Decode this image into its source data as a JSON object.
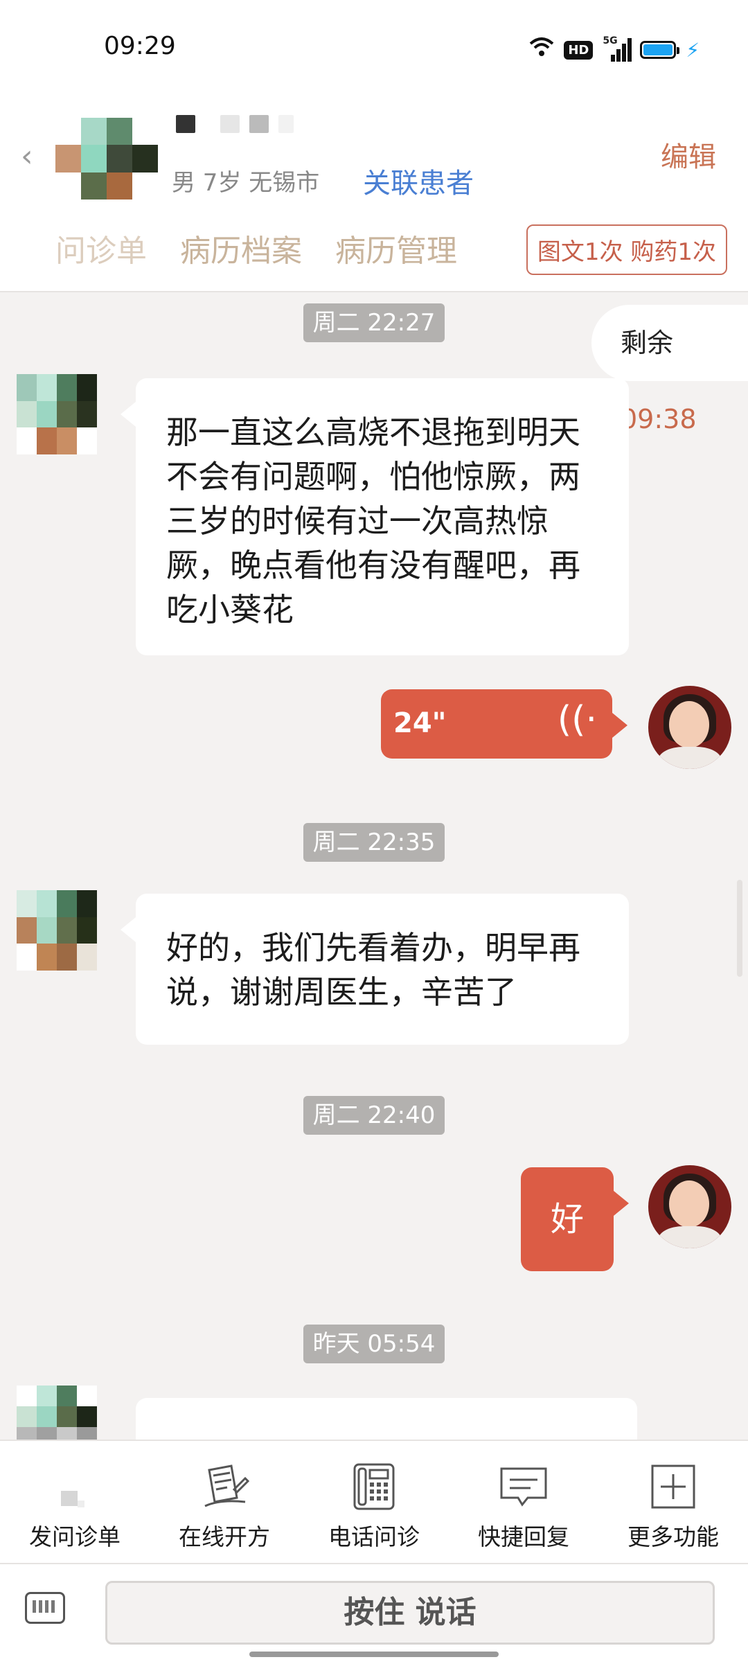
{
  "status_bar": {
    "time": "09:29",
    "network": "5G",
    "hd_label": "HD"
  },
  "header": {
    "patient_meta": "男 7岁  无锡市",
    "link_patient": "关联患者",
    "edit_button": "编辑",
    "tabs": [
      "问诊单",
      "病历档案",
      "病历管理"
    ],
    "service_chip": "图文1次 购药1次"
  },
  "chat": {
    "remain_label": "剩余",
    "remain_time": "09:38",
    "messages": [
      {
        "time": "周二 22:27",
        "text": "那一直这么高烧不退拖到明天不会有问题啊，怕他惊厥，两三岁的时候有过一次高热惊厥，晚点看他有没有醒吧，再吃小葵花"
      },
      {
        "voice_duration": "24\""
      },
      {
        "time": "周二 22:35",
        "text": "好的，我们先看着办，明早再说，谢谢周医生，辛苦了"
      },
      {
        "time": "周二 22:40",
        "reply": "好"
      },
      {
        "time": "昨天 05:54"
      }
    ]
  },
  "toolbar": {
    "items": [
      {
        "label": "发问诊单",
        "icon": "form-icon"
      },
      {
        "label": "在线开方",
        "icon": "prescription-icon"
      },
      {
        "label": "电话问诊",
        "icon": "phone-icon"
      },
      {
        "label": "快捷回复",
        "icon": "quick-reply-icon"
      },
      {
        "label": "更多功能",
        "icon": "plus-icon"
      }
    ]
  },
  "input": {
    "talk_label": "按住 说话"
  },
  "colors": {
    "accent": "#dc5c45",
    "link": "#4a7fd3",
    "tab": "#c9b49c",
    "timestamp_bg": "#b3b1af"
  }
}
